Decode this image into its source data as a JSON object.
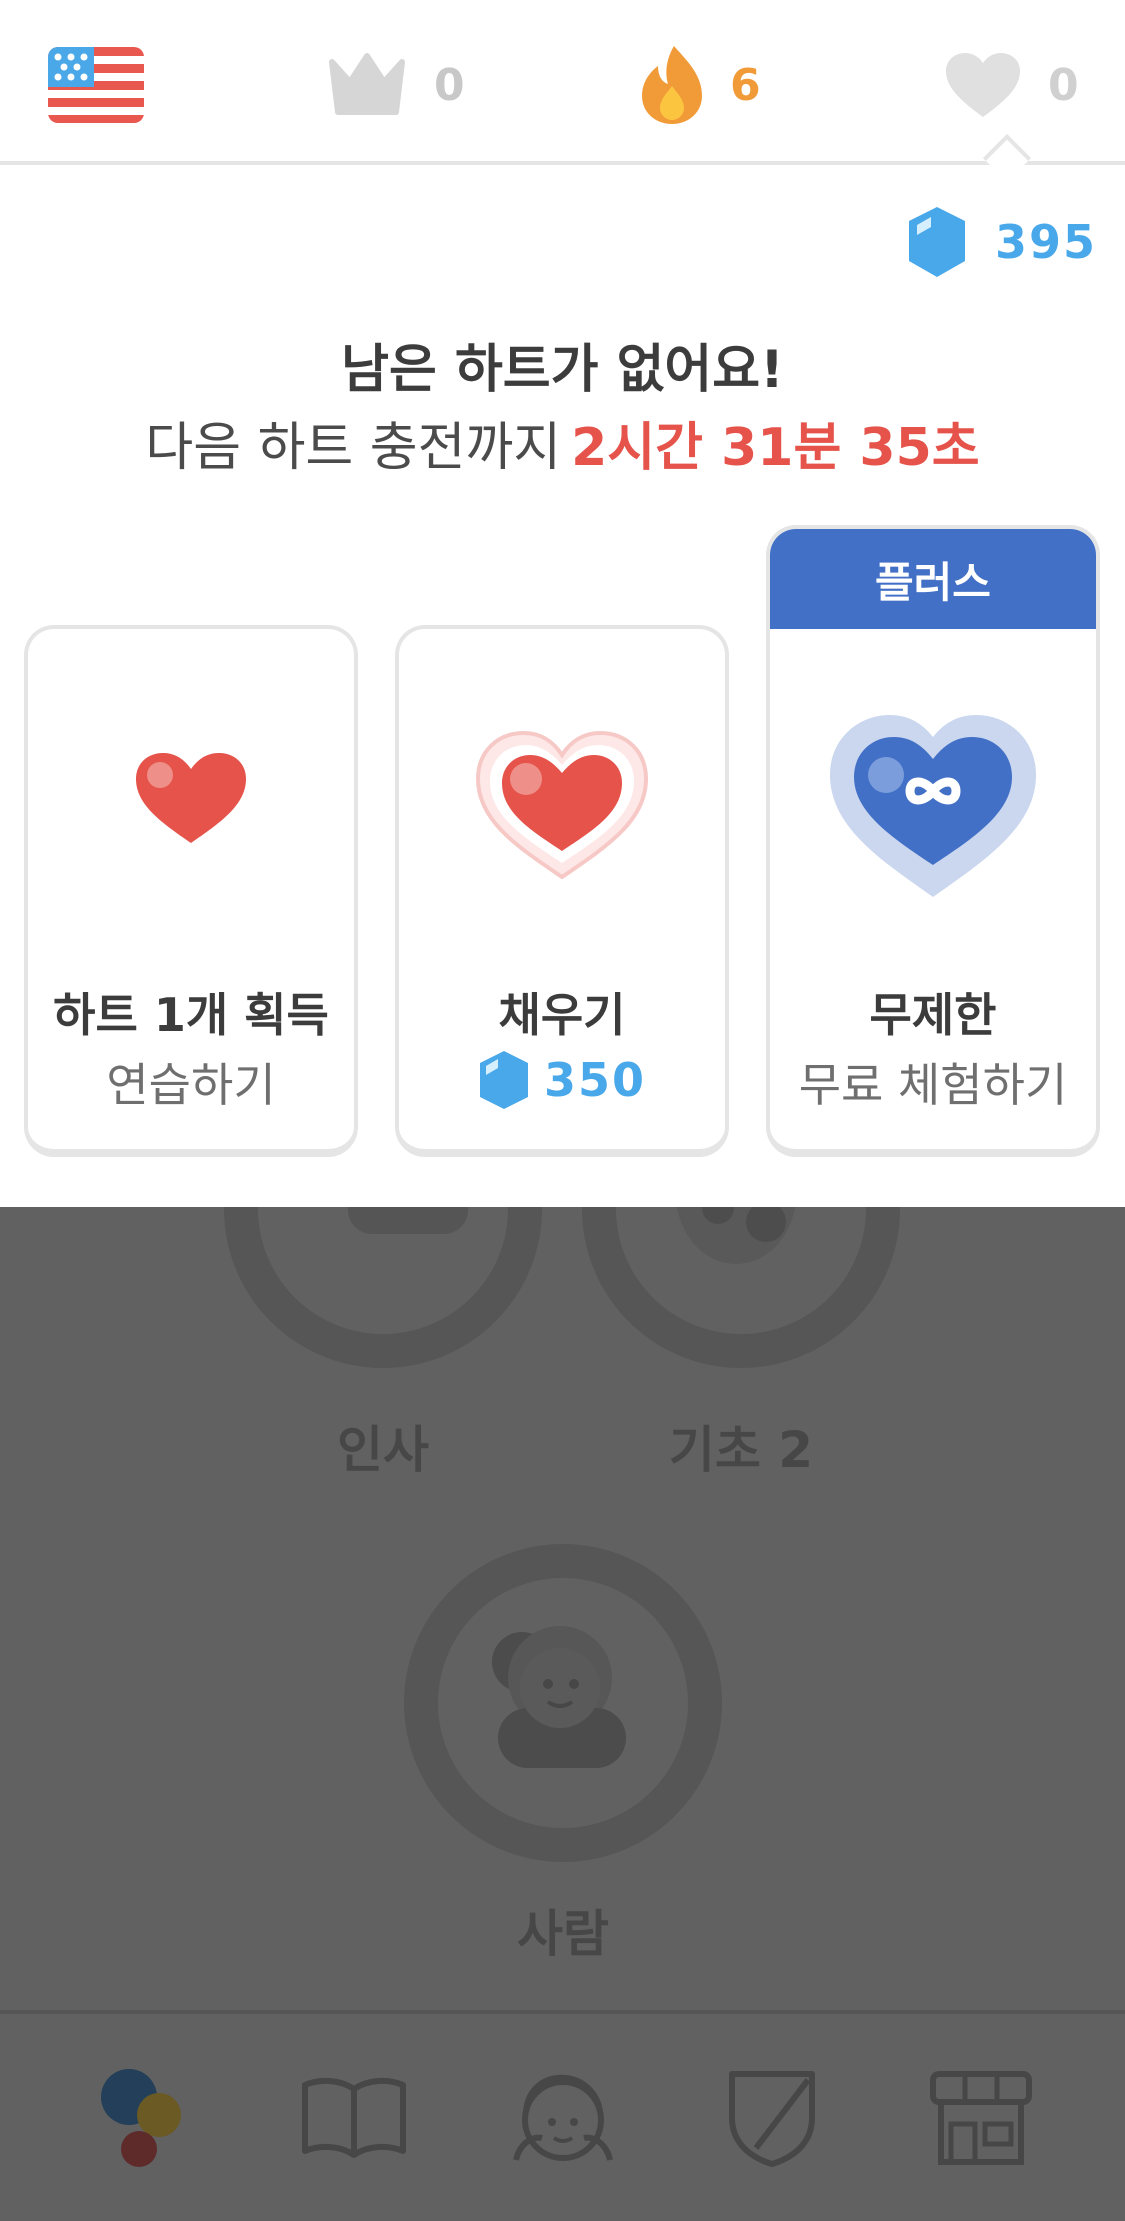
{
  "status_bar": {
    "flag_icon": "us-flag-icon",
    "crowns": "0",
    "streak": "6",
    "hearts": "0"
  },
  "gems": {
    "count": "395"
  },
  "popup": {
    "title": "남은 하트가 없어요!",
    "subtitle_prefix": "다음 하트 충전까지",
    "timer": "2시간 31분 35초"
  },
  "cards": [
    {
      "title": "하트 1개 획득",
      "subtitle": "연습하기"
    },
    {
      "title": "채우기",
      "price": "350"
    },
    {
      "badge": "플러스",
      "title": "무제한",
      "subtitle": "무료 체험하기"
    }
  ],
  "map": {
    "nodes": [
      "인사",
      "기초 2",
      "사람"
    ]
  },
  "colors": {
    "accent_red": "#e5534b",
    "gem_blue": "#49a8ea",
    "plus_blue": "#4270c6",
    "streak_orange": "#f19b38",
    "overlay": "#616161"
  }
}
